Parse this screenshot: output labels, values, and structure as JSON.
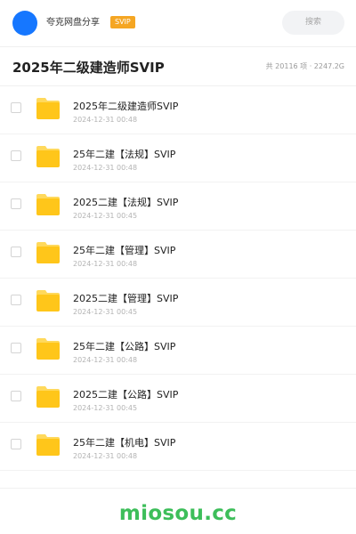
{
  "header": {
    "title": "夸克网盘分享",
    "badge": "SVIP",
    "search_placeholder": "搜索",
    "avatar_color": "#1677ff",
    "badge_color": "#f5a623"
  },
  "folder": {
    "title": "2025年二级建造师SVIP",
    "meta": "共 20116 项 · 2247.2G"
  },
  "files": [
    {
      "name": "2025年二级建造师SVIP",
      "date": "2024-12-31 00:48",
      "icon": "folder-icon"
    },
    {
      "name": "25年二建【法规】SVIP",
      "date": "2024-12-31 00:48",
      "icon": "folder-icon"
    },
    {
      "name": "2025二建【法规】SVIP",
      "date": "2024-12-31 00:45",
      "icon": "folder-icon"
    },
    {
      "name": "25年二建【管理】SVIP",
      "date": "2024-12-31 00:48",
      "icon": "folder-icon"
    },
    {
      "name": "2025二建【管理】SVIP",
      "date": "2024-12-31 00:45",
      "icon": "folder-icon"
    },
    {
      "name": "25年二建【公路】SVIP",
      "date": "2024-12-31 00:48",
      "icon": "folder-icon"
    },
    {
      "name": "2025二建【公路】SVIP",
      "date": "2024-12-31 00:45",
      "icon": "folder-icon"
    },
    {
      "name": "25年二建【机电】SVIP",
      "date": "2024-12-31 00:48",
      "icon": "folder-icon"
    }
  ],
  "footer": {
    "brand": "miosou.cc",
    "brand_color": "#3dbe5a"
  },
  "colors": {
    "folder_yellow": "#ffc61a",
    "folder_tab": "#ffd95c"
  }
}
